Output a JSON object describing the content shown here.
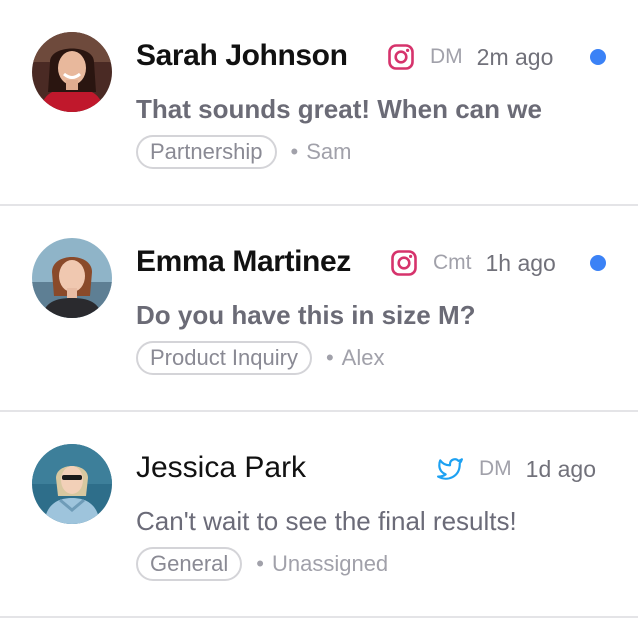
{
  "conversations": [
    {
      "name": "Sarah Johnson",
      "platform_icon": "instagram-icon",
      "type": "DM",
      "time": "2m ago",
      "unread": true,
      "preview": "That sounds great! When can we",
      "tag": "Partnership",
      "assignee": "Sam"
    },
    {
      "name": "Emma Martinez",
      "platform_icon": "instagram-icon",
      "type": "Cmt",
      "time": "1h ago",
      "unread": true,
      "preview": "Do you have this in size M?",
      "tag": "Product Inquiry",
      "assignee": "Alex"
    },
    {
      "name": "Jessica Park",
      "platform_icon": "twitter-icon",
      "type": "DM",
      "time": "1d ago",
      "unread": false,
      "preview": "Can't wait to see the final results!",
      "tag": "General",
      "assignee": "Unassigned"
    }
  ],
  "separator": "•",
  "colors": {
    "instagram": "#d6336c",
    "twitter": "#1da1f2",
    "unread_dot": "#3b82f6"
  }
}
